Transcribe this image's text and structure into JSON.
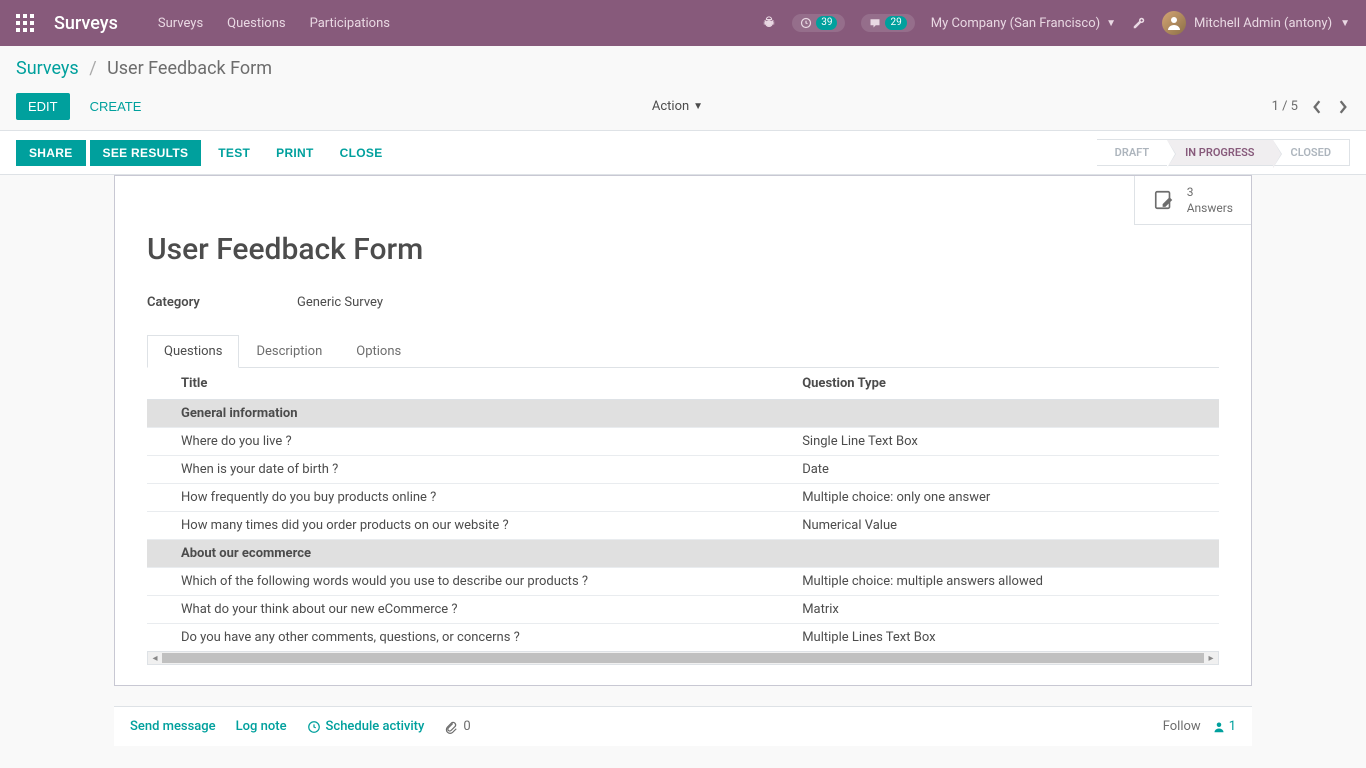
{
  "topbar": {
    "app_title": "Surveys",
    "nav": [
      "Surveys",
      "Questions",
      "Participations"
    ],
    "activities_count": "39",
    "messages_count": "29",
    "company": "My Company (San Francisco)",
    "user_name": "Mitchell Admin (antony)"
  },
  "breadcrumb": {
    "root": "Surveys",
    "current": "User Feedback Form"
  },
  "controls": {
    "edit": "EDIT",
    "create": "CREATE",
    "action": "Action",
    "pager": "1 / 5"
  },
  "statusbar": {
    "share": "SHARE",
    "see_results": "SEE RESULTS",
    "test": "TEST",
    "print": "PRINT",
    "close": "CLOSE",
    "stages": {
      "draft": "DRAFT",
      "in_progress": "IN PROGRESS",
      "closed": "CLOSED"
    }
  },
  "statbutton": {
    "count": "3",
    "label": "Answers"
  },
  "record": {
    "title": "User Feedback Form",
    "category_label": "Category",
    "category_value": "Generic Survey"
  },
  "tabs": [
    "Questions",
    "Description",
    "Options"
  ],
  "questions_table": {
    "col_title": "Title",
    "col_type": "Question Type",
    "rows": [
      {
        "section": true,
        "title": "General information",
        "type": ""
      },
      {
        "section": false,
        "title": "Where do you live ?",
        "type": "Single Line Text Box"
      },
      {
        "section": false,
        "title": "When is your date of birth ?",
        "type": "Date"
      },
      {
        "section": false,
        "title": "How frequently do you buy products online ?",
        "type": "Multiple choice: only one answer"
      },
      {
        "section": false,
        "title": "How many times did you order products on our website ?",
        "type": "Numerical Value"
      },
      {
        "section": true,
        "title": "About our ecommerce",
        "type": ""
      },
      {
        "section": false,
        "title": "Which of the following words would you use to describe our products ?",
        "type": "Multiple choice: multiple answers allowed"
      },
      {
        "section": false,
        "title": "What do your think about our new eCommerce ?",
        "type": "Matrix"
      },
      {
        "section": false,
        "title": "Do you have any other comments, questions, or concerns ?",
        "type": "Multiple Lines Text Box"
      }
    ]
  },
  "chatter": {
    "send": "Send message",
    "log": "Log note",
    "schedule": "Schedule activity",
    "attach_count": "0",
    "follow": "Follow",
    "followers": "1"
  }
}
